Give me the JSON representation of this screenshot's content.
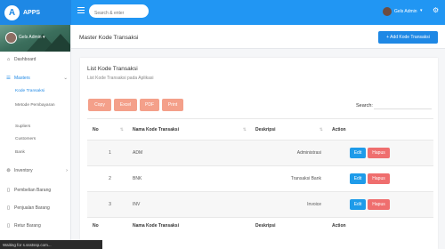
{
  "brand": {
    "logo_letter": "A",
    "name": "APPS",
    "color": "#1e88e5"
  },
  "topbar": {
    "search_placeholder": "Search & enter",
    "user_name": "Gels Admin",
    "caret": "▾",
    "gear": "⚙"
  },
  "sidebar": {
    "profile_name": "Gels Admin ▾",
    "items": [
      {
        "label": "Dashboard",
        "icon": "⌂"
      },
      {
        "label": "Masters",
        "icon": "☰",
        "arrow": "⌄"
      },
      {
        "label": "Inventory",
        "icon": "⊚",
        "arrow": "›"
      },
      {
        "label": "Pembelian Barang",
        "icon": "▯"
      },
      {
        "label": "Penjualan Barang",
        "icon": "▯"
      },
      {
        "label": "Retur Barang",
        "icon": "▯"
      }
    ],
    "subitems": [
      "Kode Transaksi",
      "Metode Pembayaran",
      "Supliers",
      "Customers",
      "Bank"
    ]
  },
  "page": {
    "title": "Master Kode Transaksi",
    "add_button": "+ Add Kode Transaksi"
  },
  "card": {
    "title": "List Kode Transaksi",
    "subtitle": "List Kode Transaksi pada Aplikasi",
    "export_buttons": [
      "Copy",
      "Excel",
      "PDF",
      "Print"
    ],
    "search_label": "Search:"
  },
  "table": {
    "headers": [
      "No",
      "Nama Kode Transaksi",
      "Deskripsi",
      "Action"
    ],
    "sort_icon": "⇅",
    "rows": [
      {
        "no": "1",
        "nama": "ADM",
        "deskripsi": "Administrasi"
      },
      {
        "no": "2",
        "nama": "BNK",
        "deskripsi": "Transaksi Bank"
      },
      {
        "no": "3",
        "nama": "INV",
        "deskripsi": "Invoice"
      }
    ],
    "edit_label": "Edit",
    "hapus_label": "Hapus"
  },
  "status_bar": "Waiting for s.ssstssp.com..."
}
